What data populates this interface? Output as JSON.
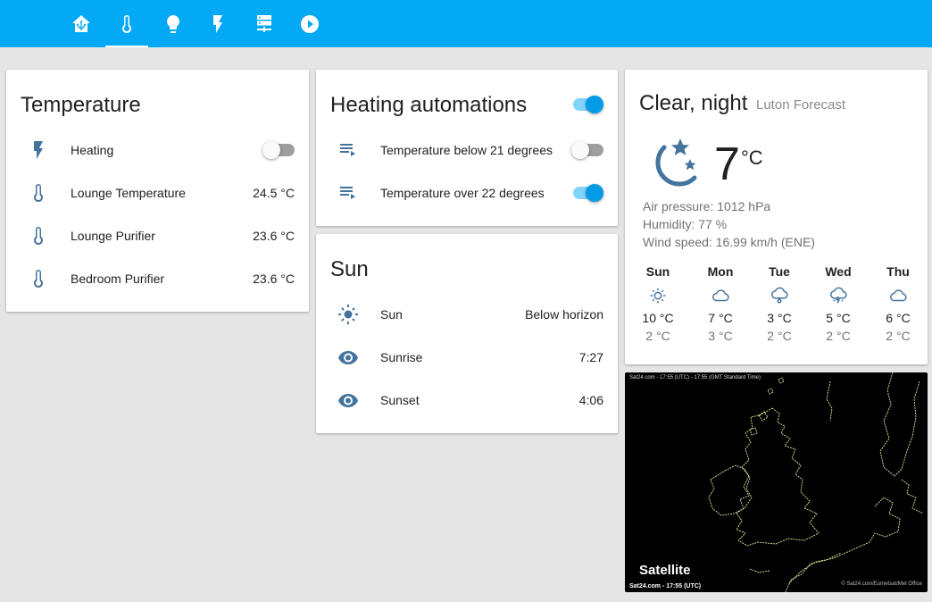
{
  "header": {
    "tabs": [
      {
        "name": "home",
        "icon": "home-assistant-icon",
        "active": false
      },
      {
        "name": "temperature",
        "icon": "thermometer-icon",
        "active": true
      },
      {
        "name": "lights",
        "icon": "lightbulb-icon",
        "active": false
      },
      {
        "name": "power",
        "icon": "flash-icon",
        "active": false
      },
      {
        "name": "servers",
        "icon": "server-icon",
        "active": false
      },
      {
        "name": "media",
        "icon": "play-circle-icon",
        "active": false
      }
    ],
    "accent": "#03a9f4"
  },
  "temperature_card": {
    "title": "Temperature",
    "rows": [
      {
        "label": "Heating",
        "icon": "flash-icon",
        "toggle": false
      },
      {
        "label": "Lounge Temperature",
        "icon": "thermometer-icon",
        "value": "24.5 °C"
      },
      {
        "label": "Lounge Purifier",
        "icon": "thermometer-icon",
        "value": "23.6 °C"
      },
      {
        "label": "Bedroom Purifier",
        "icon": "thermometer-icon",
        "value": "23.6 °C"
      }
    ]
  },
  "automations_card": {
    "title": "Heating automations",
    "group_toggle": true,
    "rows": [
      {
        "label": "Temperature below 21 degrees",
        "icon": "playlist-play-icon",
        "toggle": false
      },
      {
        "label": "Temperature over 22 degrees",
        "icon": "playlist-play-icon",
        "toggle": true
      }
    ]
  },
  "sun_card": {
    "title": "Sun",
    "rows": [
      {
        "label": "Sun",
        "icon": "sun-icon",
        "value": "Below horizon"
      },
      {
        "label": "Sunrise",
        "icon": "eye-icon",
        "value": "7:27"
      },
      {
        "label": "Sunset",
        "icon": "eye-icon",
        "value": "4:06"
      }
    ]
  },
  "weather_card": {
    "condition": "Clear, night",
    "location": "Luton Forecast",
    "icon": "night-moon-stars-icon",
    "temperature": "7",
    "unit": "°C",
    "attributes": [
      "Air pressure: 1012 hPa",
      "Humidity: 77 %",
      "Wind speed: 16.99 km/h (ENE)"
    ],
    "forecast": [
      {
        "day": "Sun",
        "icon": "sunny-icon",
        "high": "10 °C",
        "low": "2 °C"
      },
      {
        "day": "Mon",
        "icon": "cloudy-icon",
        "high": "7 °C",
        "low": "3 °C"
      },
      {
        "day": "Tue",
        "icon": "rain-icon",
        "high": "3 °C",
        "low": "2 °C"
      },
      {
        "day": "Wed",
        "icon": "lightning-rain-icon",
        "high": "5 °C",
        "low": "2 °C"
      },
      {
        "day": "Thu",
        "icon": "cloudy-icon",
        "high": "6 °C",
        "low": "2 °C"
      }
    ]
  },
  "satellite_card": {
    "title": "Satellite",
    "top_caption": "Sat24.com - 17:55 (UTC) - 17:55 (GMT Standard Time)",
    "bottom_caption": "Sat24.com - 17:55 (UTC)",
    "credit": "© Sat24.com/Eumetsat/Met Office"
  }
}
